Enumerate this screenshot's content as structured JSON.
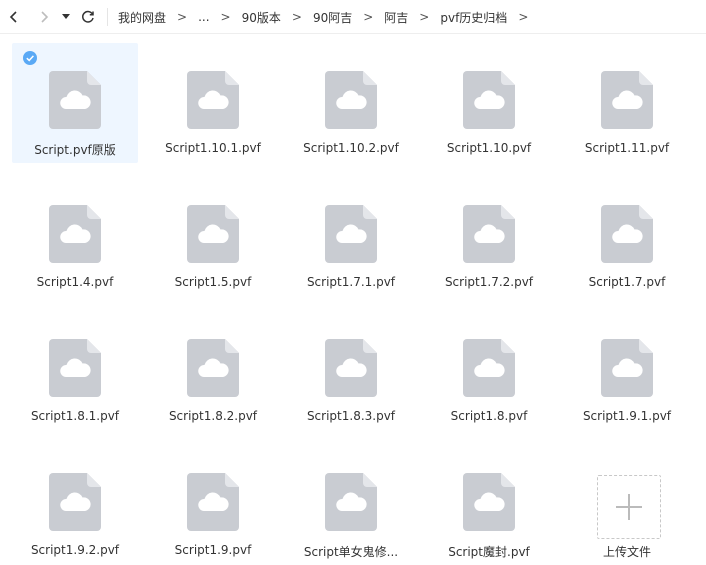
{
  "breadcrumb": [
    "我的网盘",
    "...",
    "90版本",
    "90阿吉",
    "阿吉",
    "pvf历史归档"
  ],
  "breadcrumb_sep": ">",
  "files": [
    {
      "name": "Script.pvf原版",
      "selected": true
    },
    {
      "name": "Script1.10.1.pvf"
    },
    {
      "name": "Script1.10.2.pvf"
    },
    {
      "name": "Script1.10.pvf"
    },
    {
      "name": "Script1.11.pvf"
    },
    {
      "name": "Script1.4.pvf"
    },
    {
      "name": "Script1.5.pvf"
    },
    {
      "name": "Script1.7.1.pvf"
    },
    {
      "name": "Script1.7.2.pvf"
    },
    {
      "name": "Script1.7.pvf"
    },
    {
      "name": "Script1.8.1.pvf"
    },
    {
      "name": "Script1.8.2.pvf"
    },
    {
      "name": "Script1.8.3.pvf"
    },
    {
      "name": "Script1.8.pvf"
    },
    {
      "name": "Script1.9.1.pvf"
    },
    {
      "name": "Script1.9.2.pvf"
    },
    {
      "name": "Script1.9.pvf"
    },
    {
      "name": "Script单女鬼修..."
    },
    {
      "name": "Script魔封.pvf"
    }
  ],
  "upload_label": "上传文件",
  "colors": {
    "icon_body": "#c9ccd2",
    "icon_fold": "#e4e6ea",
    "cloud": "#ffffff",
    "selected_bg": "#eef6ff",
    "check": "#5aa9f5"
  }
}
